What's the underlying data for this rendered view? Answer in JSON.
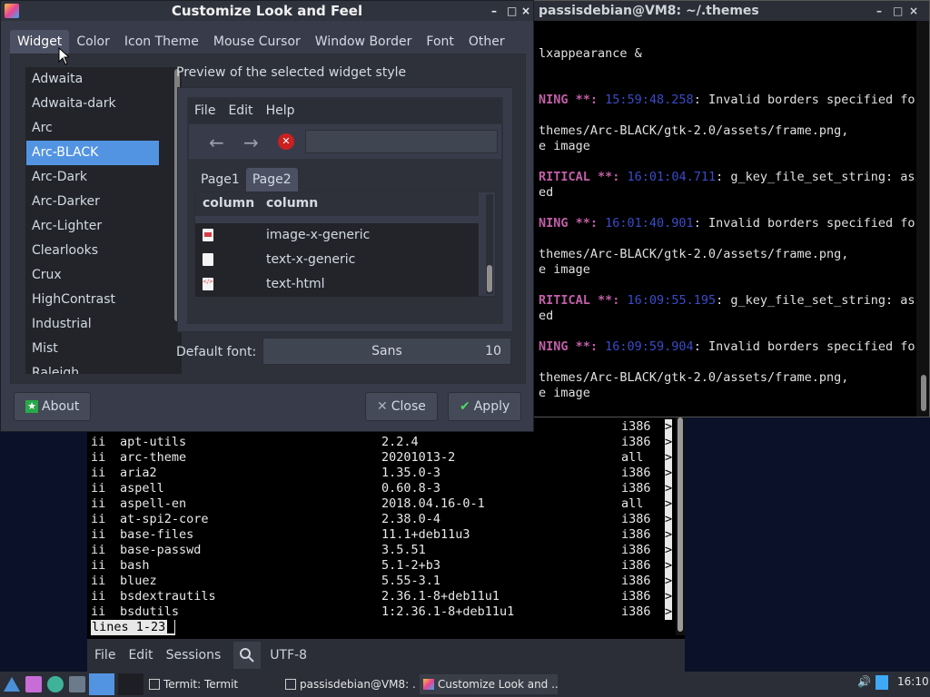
{
  "terminal_right": {
    "title": "passisdebian@VM8: ~/.themes",
    "lines": [
      {
        "pre": "lxappearance &",
        "kw": "",
        "ts": "",
        "post": ""
      },
      {
        "pre": "",
        "kw": "NING **: ",
        "ts": "15:59:48.258",
        "post": ": Invalid borders specified for"
      },
      {
        "pre": "themes/Arc-BLACK/gtk-2.0/assets/frame.png,",
        "kw": "",
        "ts": "",
        "post": ""
      },
      {
        "pre": "e image",
        "kw": "",
        "ts": "",
        "post": ""
      },
      {
        "pre": "",
        "kw": "RITICAL **: ",
        "ts": "16:01:04.711",
        "post": ": g_key_file_set_string: asse"
      },
      {
        "pre": "ed",
        "kw": "",
        "ts": "",
        "post": ""
      },
      {
        "pre": "",
        "kw": "NING **: ",
        "ts": "16:01:40.901",
        "post": ": Invalid borders specified for"
      },
      {
        "pre": "themes/Arc-BLACK/gtk-2.0/assets/frame.png,",
        "kw": "",
        "ts": "",
        "post": ""
      },
      {
        "pre": "e image",
        "kw": "",
        "ts": "",
        "post": ""
      },
      {
        "pre": "",
        "kw": "RITICAL **: ",
        "ts": "16:09:55.195",
        "post": ": g_key_file_set_string: asse"
      },
      {
        "pre": "ed",
        "kw": "",
        "ts": "",
        "post": ""
      },
      {
        "pre": "",
        "kw": "NING **: ",
        "ts": "16:09:59.904",
        "post": ": Invalid borders specified for"
      },
      {
        "pre": "themes/Arc-BLACK/gtk-2.0/assets/frame.png,",
        "kw": "",
        "ts": "",
        "post": ""
      },
      {
        "pre": "e image",
        "kw": "",
        "ts": "",
        "post": ""
      }
    ]
  },
  "terminal_bottom": {
    "top_partial": {
      "arch": "i386",
      "mark": ">"
    },
    "packages": [
      {
        "st": "ii",
        "name": "apt-utils",
        "ver": "2.2.4",
        "arch": "i386",
        "mark": ">"
      },
      {
        "st": "ii",
        "name": "arc-theme",
        "ver": "20201013-2",
        "arch": "all",
        "mark": ">"
      },
      {
        "st": "ii",
        "name": "aria2",
        "ver": "1.35.0-3",
        "arch": "i386",
        "mark": ">"
      },
      {
        "st": "ii",
        "name": "aspell",
        "ver": "0.60.8-3",
        "arch": "i386",
        "mark": ">"
      },
      {
        "st": "ii",
        "name": "aspell-en",
        "ver": "2018.04.16-0-1",
        "arch": "all",
        "mark": ">"
      },
      {
        "st": "ii",
        "name": "at-spi2-core",
        "ver": "2.38.0-4",
        "arch": "i386",
        "mark": ">"
      },
      {
        "st": "ii",
        "name": "base-files",
        "ver": "11.1+deb11u3",
        "arch": "i386",
        "mark": ">"
      },
      {
        "st": "ii",
        "name": "base-passwd",
        "ver": "3.5.51",
        "arch": "i386",
        "mark": ">"
      },
      {
        "st": "ii",
        "name": "bash",
        "ver": "5.1-2+b3",
        "arch": "i386",
        "mark": ">"
      },
      {
        "st": "ii",
        "name": "bluez",
        "ver": "5.55-3.1",
        "arch": "i386",
        "mark": ">"
      },
      {
        "st": "ii",
        "name": "bsdextrautils",
        "ver": "2.36.1-8+deb11u1",
        "arch": "i386",
        "mark": ">"
      },
      {
        "st": "ii",
        "name": "bsdutils",
        "ver": "1:2.36.1-8+deb11u1",
        "arch": "i386",
        "mark": ">"
      }
    ],
    "status": "lines 1-23",
    "menu": {
      "file": "File",
      "edit": "Edit",
      "sessions": "Sessions",
      "encoding": "UTF-8"
    }
  },
  "dialog": {
    "title": "Customize Look and Feel",
    "window_controls": [
      "–",
      "□",
      "×"
    ],
    "tabs": [
      "Widget",
      "Color",
      "Icon Theme",
      "Mouse Cursor",
      "Window Border",
      "Font",
      "Other"
    ],
    "active_tab": "Widget",
    "themes": [
      "Adwaita",
      "Adwaita-dark",
      "Arc",
      "Arc-BLACK",
      "Arc-Dark",
      "Arc-Darker",
      "Arc-Lighter",
      "Clearlooks",
      "Crux",
      "HighContrast",
      "Industrial",
      "Mist",
      "Raleigh"
    ],
    "selected_theme": "Arc-BLACK",
    "preview_label": "Preview of the selected widget style",
    "preview": {
      "menu": [
        "File",
        "Edit",
        "Help"
      ],
      "tabs": [
        "Page1",
        "Page2"
      ],
      "active_tab": "Page2",
      "columns": [
        "column",
        "column"
      ],
      "rows": [
        {
          "icon": "image-icon",
          "label": "image-x-generic"
        },
        {
          "icon": "text-file-icon",
          "label": "text-x-generic"
        },
        {
          "icon": "html-file-icon",
          "label": "text-html"
        }
      ]
    },
    "font_label": "Default font:",
    "font_name": "Sans",
    "font_size": "10",
    "buttons": {
      "about": "About",
      "close": "Close",
      "apply": "Apply"
    }
  },
  "taskbar": {
    "tasks": [
      "Termit: Termit",
      "passisdebian@VM8: ...",
      "Customize Look and ..."
    ],
    "clock": "16:10"
  },
  "colors": {
    "accent": "#5294e2",
    "error": "#cc1f1f",
    "warn_keyword": "#c25fa8",
    "timestamp": "#3b4bc8"
  }
}
